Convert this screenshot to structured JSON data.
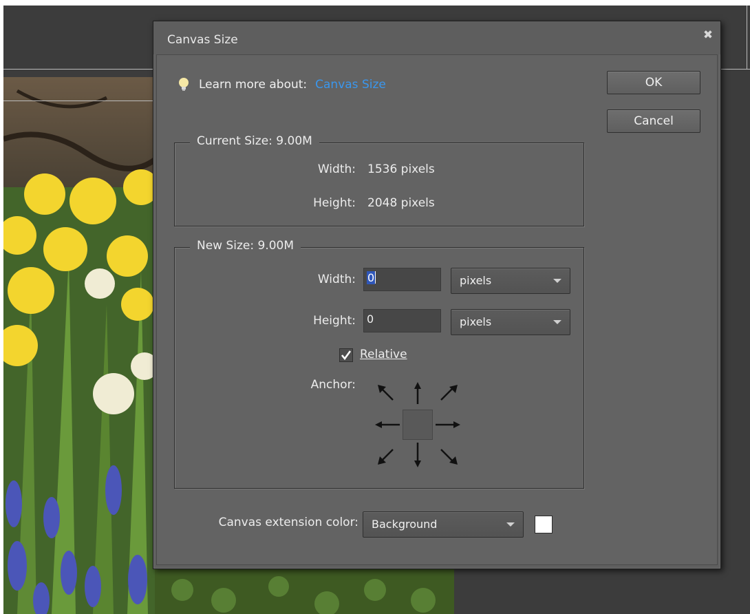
{
  "dialog": {
    "title": "Canvas Size",
    "close_icon": "close-icon",
    "learn_more_label": "Learn more about:",
    "learn_more_link": "Canvas Size",
    "ok_label": "OK",
    "cancel_label": "Cancel"
  },
  "current_size": {
    "legend": "Current Size: 9.00M",
    "width_label": "Width:",
    "width_value": "1536 pixels",
    "height_label": "Height:",
    "height_value": "2048 pixels"
  },
  "new_size": {
    "legend": "New Size: 9.00M",
    "width_label": "Width:",
    "width_value": "0",
    "width_unit": "pixels",
    "height_label": "Height:",
    "height_value": "0",
    "height_unit": "pixels",
    "relative_label": "Relative",
    "relative_checked": true,
    "anchor_label": "Anchor:"
  },
  "extension": {
    "label": "Canvas extension color:",
    "value": "Background",
    "swatch_color": "#ffffff"
  },
  "colors": {
    "link": "#3a97ee",
    "dialog_bg": "#636363",
    "selection": "#2f56b8"
  }
}
